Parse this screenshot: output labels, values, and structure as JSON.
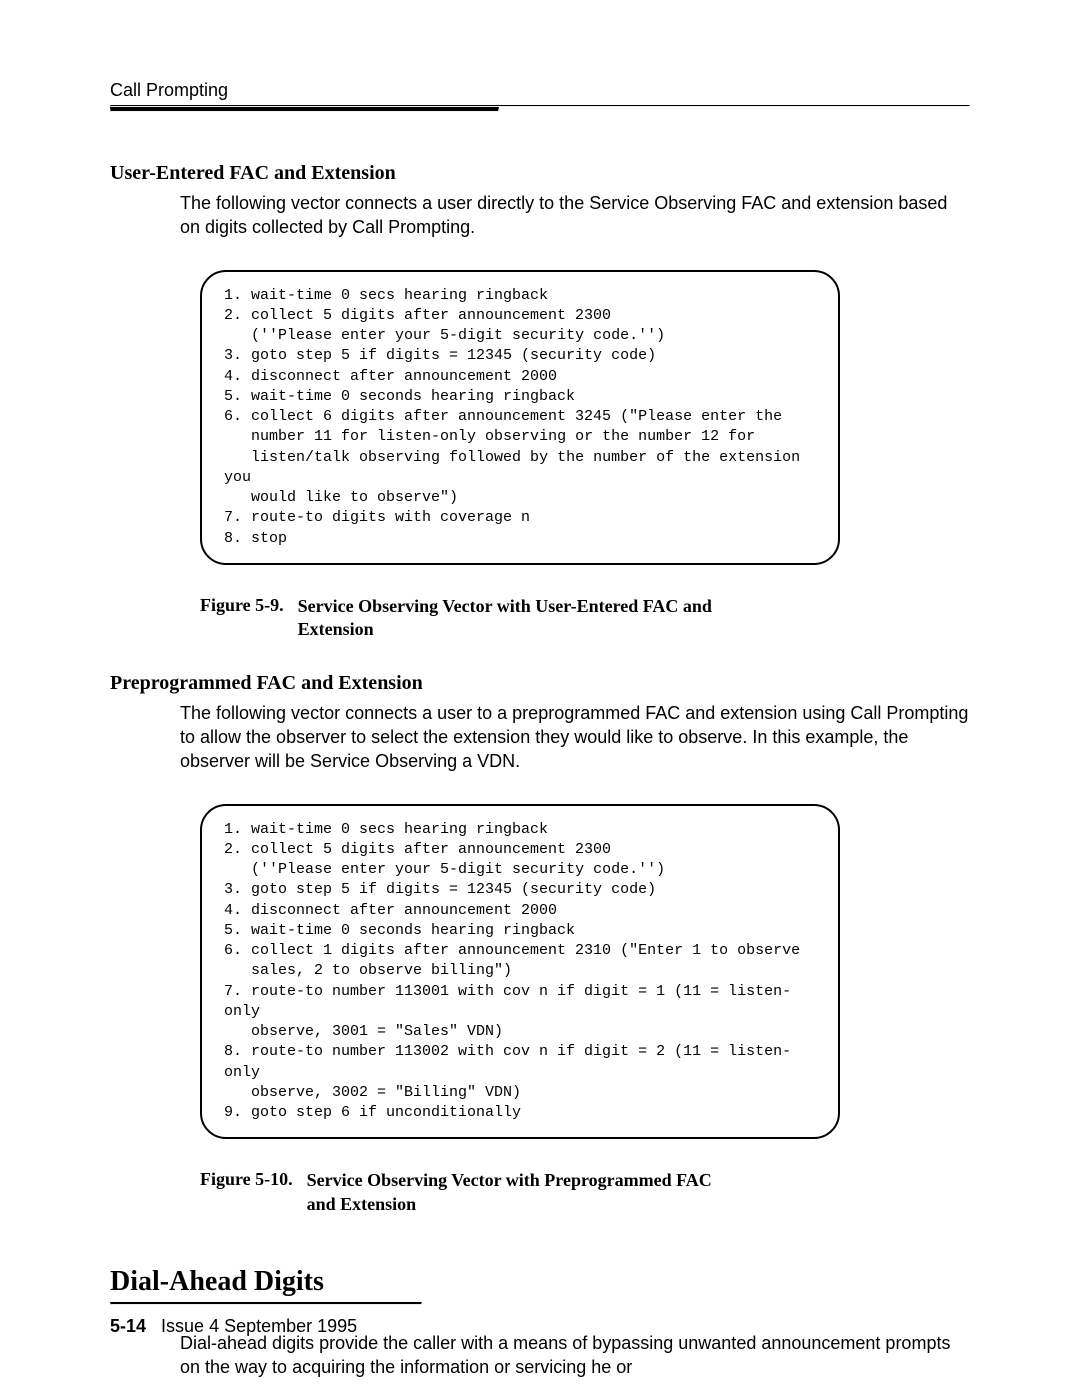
{
  "runningHead": "Call Prompting",
  "sections": {
    "s1": {
      "heading": "User-Entered FAC and Extension",
      "body": "The following vector connects a user directly to the Service Observing FAC and extension based on digits collected by Call Prompting.",
      "code": "1. wait-time 0 secs hearing ringback\n2. collect 5 digits after announcement 2300\n   (''Please enter your 5-digit security code.'')\n3. goto step 5 if digits = 12345 (security code)\n4. disconnect after announcement 2000\n5. wait-time 0 seconds hearing ringback\n6. collect 6 digits after announcement 3245 (\"Please enter the\n   number 11 for listen-only observing or the number 12 for\n   listen/talk observing followed by the number of the extension you\n   would like to observe\")\n7. route-to digits with coverage n\n8. stop",
      "figLabel": "Figure 5-9.",
      "figText": "Service Observing Vector with User-Entered FAC and Extension"
    },
    "s2": {
      "heading": "Preprogrammed FAC and Extension",
      "body": "The following vector connects a user to a preprogrammed FAC and extension using Call Prompting to allow the observer to select the extension they would like to observe. In this example, the observer will be Service Observing a VDN.",
      "code": "1. wait-time 0 secs hearing ringback\n2. collect 5 digits after announcement 2300\n   (''Please enter your 5-digit security code.'')\n3. goto step 5 if digits = 12345 (security code)\n4. disconnect after announcement 2000\n5. wait-time 0 seconds hearing ringback\n6. collect 1 digits after announcement 2310 (\"Enter 1 to observe\n   sales, 2 to observe billing\")\n7. route-to number 113001 with cov n if digit = 1 (11 = listen-only\n   observe, 3001 = \"Sales\" VDN)\n8. route-to number 113002 with cov n if digit = 2 (11 = listen-only\n   observe, 3002 = \"Billing\" VDN)\n9. goto step 6 if unconditionally",
      "figLabel": "Figure 5-10.",
      "figText": "Service Observing Vector with Preprogrammed FAC and Extension"
    },
    "s3": {
      "title": "Dial-Ahead Digits",
      "body": "Dial-ahead digits provide the caller with a means of bypassing unwanted announcement prompts on the way to acquiring the information or servicing he or"
    }
  },
  "footer": {
    "pageNum": "5-14",
    "issue": "Issue 4 September 1995"
  }
}
